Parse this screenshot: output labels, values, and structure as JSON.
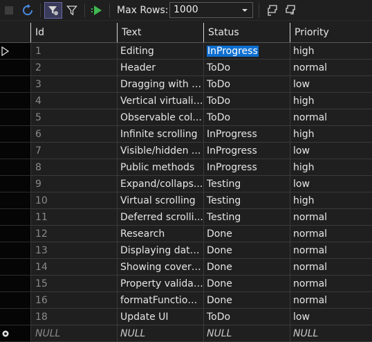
{
  "toolbar": {
    "max_rows_label": "Max Rows:",
    "max_rows_value": "1000",
    "icons": [
      "stop-icon",
      "refresh-icon",
      "filter-pane-icon",
      "filter-icon",
      "execute-icon",
      "chevron-down-icon",
      "copy-script-icon",
      "paste-script-icon"
    ]
  },
  "grid": {
    "columns": [
      "Id",
      "Text",
      "Status",
      "Priority"
    ],
    "rows": [
      {
        "id": "1",
        "text": "Editing",
        "status": "InProgress",
        "priority": "high"
      },
      {
        "id": "2",
        "text": "Header",
        "status": "ToDo",
        "priority": "normal"
      },
      {
        "id": "3",
        "text": "Dragging with f...",
        "status": "ToDo",
        "priority": "low"
      },
      {
        "id": "4",
        "text": "Vertical virtualiz...",
        "status": "ToDo",
        "priority": "high"
      },
      {
        "id": "5",
        "text": "Observable col...",
        "status": "ToDo",
        "priority": "normal"
      },
      {
        "id": "6",
        "text": "Infinite scrolling",
        "status": "InProgress",
        "priority": "high"
      },
      {
        "id": "7",
        "text": "Visible/hidden ...",
        "status": "InProgress",
        "priority": "low"
      },
      {
        "id": "8",
        "text": "Public methods",
        "status": "InProgress",
        "priority": "high"
      },
      {
        "id": "9",
        "text": "Expand/collaps...",
        "status": "Testing",
        "priority": "low"
      },
      {
        "id": "10",
        "text": "Virtual scrolling",
        "status": "Testing",
        "priority": "high"
      },
      {
        "id": "11",
        "text": "Deferred scrolli...",
        "status": "Testing",
        "priority": "normal"
      },
      {
        "id": "12",
        "text": "Research",
        "status": "Done",
        "priority": "normal"
      },
      {
        "id": "13",
        "text": "Displaying data...",
        "status": "Done",
        "priority": "normal"
      },
      {
        "id": "14",
        "text": "Showing cover ...",
        "status": "Done",
        "priority": "normal"
      },
      {
        "id": "15",
        "text": "Property validat...",
        "status": "Done",
        "priority": "normal"
      },
      {
        "id": "16",
        "text": "formatFunction ...",
        "status": "Done",
        "priority": "normal"
      },
      {
        "id": "18",
        "text": "Update UI",
        "status": "ToDo",
        "priority": "low"
      }
    ],
    "new_row": {
      "id": "NULL",
      "text": "NULL",
      "status": "NULL",
      "priority": "NULL"
    },
    "current_row_index": 0,
    "selected_cell": "status"
  },
  "colors": {
    "background": "#1f1f1f",
    "row_header": "#050505",
    "selection": "#0e6fd0",
    "execute_green": "#3fb950"
  }
}
